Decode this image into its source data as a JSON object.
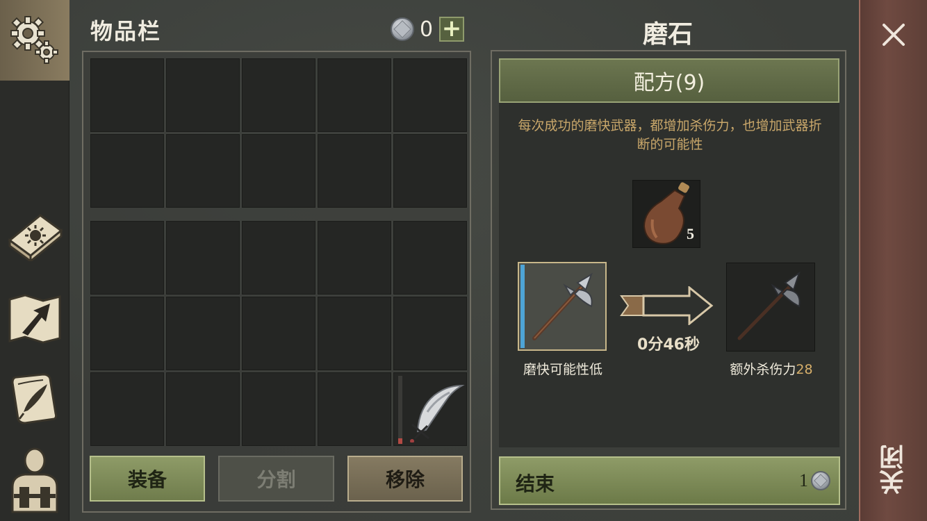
{
  "nav": {
    "items": [
      {
        "name": "settings",
        "icon": "gears-icon",
        "active": true
      },
      {
        "name": "journal",
        "icon": "sun-book-icon",
        "active": false
      },
      {
        "name": "map",
        "icon": "map-arrow-icon",
        "active": false
      },
      {
        "name": "quests",
        "icon": "quill-scroll-icon",
        "active": false
      },
      {
        "name": "character",
        "icon": "backpack-character-icon",
        "active": false
      }
    ]
  },
  "inventory": {
    "title": "物品栏",
    "currency": "0",
    "add_label": "+",
    "top_grid_cells": 10,
    "bottom_grid_cells": 15,
    "item": {
      "name": "scimitar",
      "durability": 0.08
    },
    "buttons": {
      "equip": "装备",
      "split": "分割",
      "remove": "移除"
    }
  },
  "crafting": {
    "title": "磨石",
    "recipe_tab": "配方(9)",
    "description": "每次成功的磨快武器，都增加杀伤力，也增加武器折断的可能性",
    "ingredient": {
      "name": "oil-bottle",
      "count": "5"
    },
    "input": {
      "name": "halberd",
      "label": "磨快可能性低"
    },
    "time": "0分46秒",
    "output": {
      "name": "halberd",
      "label_prefix": "额外杀伤力",
      "bonus": "28"
    },
    "finish": {
      "label": "结束",
      "cost": "1"
    }
  },
  "close": {
    "label": "关闭"
  },
  "colors": {
    "accent_green": "#8e9b67",
    "close_red": "#6f4a41",
    "desc_gold": "#c9a76a",
    "durability_blue": "#4ea4d6"
  }
}
